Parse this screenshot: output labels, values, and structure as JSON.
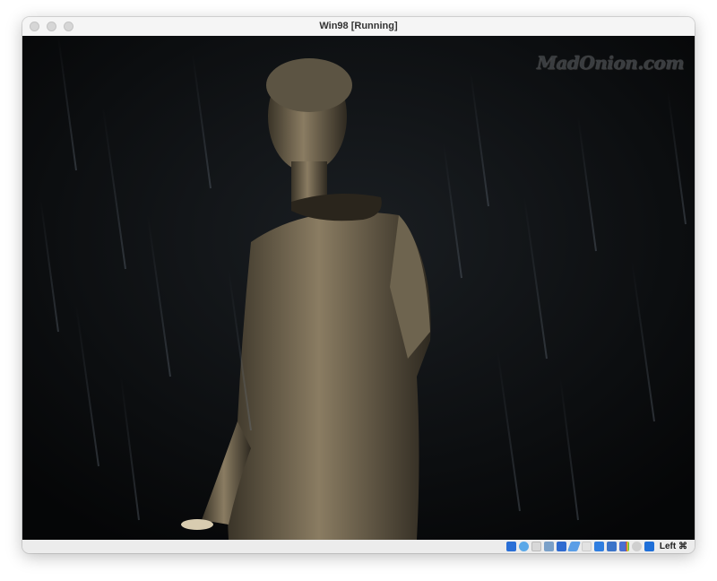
{
  "window": {
    "title": "Win98 [Running]"
  },
  "screen": {
    "logo_text": "MadOnion.com"
  },
  "statusbar": {
    "icons": [
      "hard-disk-icon",
      "optical-drive-icon",
      "floppy-icon",
      "audio-icon",
      "network-icon",
      "usb-icon",
      "shared-folders-icon",
      "display-icon",
      "video-capture-icon",
      "cpu-icon",
      "mouse-integration-icon",
      "keyboard-icon"
    ],
    "host_key": "Left ⌘"
  }
}
